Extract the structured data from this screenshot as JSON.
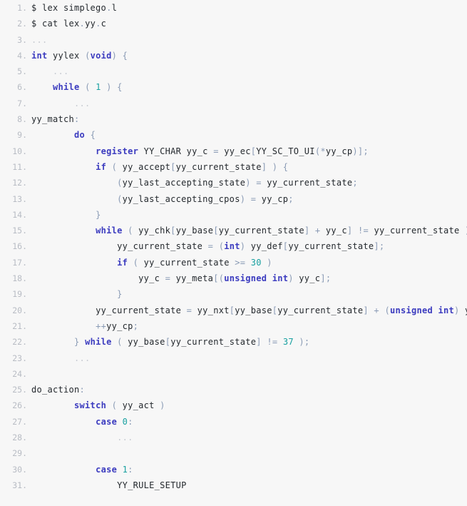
{
  "view": {
    "kind": "code-listing",
    "language": "c",
    "background_color": "#f7f7f7",
    "gutter_color": "#b8bcc4",
    "text_color": "#24292e",
    "keyword_color": "#3b3bbf",
    "number_color": "#18a0a0",
    "punctuation_color": "#8a9bb5",
    "ellipsis_color": "#c6cad1",
    "first_line_number": 1,
    "last_line_number": 31,
    "total_lines": 31
  },
  "lines": [
    {
      "n": "1",
      "text": "$ lex simplego.l",
      "tokens": [
        {
          "t": "$ lex simplego",
          "c": "t-plain"
        },
        {
          "t": ".",
          "c": "t-punct"
        },
        {
          "t": "l",
          "c": "t-plain"
        }
      ]
    },
    {
      "n": "2",
      "text": "$ cat lex.yy.c",
      "tokens": [
        {
          "t": "$ cat lex",
          "c": "t-plain"
        },
        {
          "t": ".",
          "c": "t-punct"
        },
        {
          "t": "yy",
          "c": "t-plain"
        },
        {
          "t": ".",
          "c": "t-punct"
        },
        {
          "t": "c",
          "c": "t-plain"
        }
      ]
    },
    {
      "n": "3",
      "text": "...",
      "tokens": [
        {
          "t": "...",
          "c": "t-dim"
        }
      ]
    },
    {
      "n": "4",
      "text": "int yylex (void) {",
      "tokens": [
        {
          "t": "int",
          "c": "t-type"
        },
        {
          "t": " yylex ",
          "c": "t-ident"
        },
        {
          "t": "(",
          "c": "t-punct"
        },
        {
          "t": "void",
          "c": "t-type"
        },
        {
          "t": ") {",
          "c": "t-punct"
        }
      ]
    },
    {
      "n": "5",
      "text": "    ...",
      "tokens": [
        {
          "t": "    ",
          "c": "t-plain"
        },
        {
          "t": "...",
          "c": "t-dim"
        }
      ]
    },
    {
      "n": "6",
      "text": "    while ( 1 ) {",
      "tokens": [
        {
          "t": "    ",
          "c": "t-plain"
        },
        {
          "t": "while",
          "c": "t-kw"
        },
        {
          "t": " ",
          "c": "t-plain"
        },
        {
          "t": "(",
          "c": "t-punct"
        },
        {
          "t": " ",
          "c": "t-plain"
        },
        {
          "t": "1",
          "c": "t-num"
        },
        {
          "t": " ",
          "c": "t-plain"
        },
        {
          "t": ") {",
          "c": "t-punct"
        }
      ]
    },
    {
      "n": "7",
      "text": "        ...",
      "tokens": [
        {
          "t": "        ",
          "c": "t-plain"
        },
        {
          "t": "...",
          "c": "t-dim"
        }
      ]
    },
    {
      "n": "8",
      "text": "yy_match:",
      "tokens": [
        {
          "t": "yy_match",
          "c": "t-label"
        },
        {
          "t": ":",
          "c": "t-punct"
        }
      ]
    },
    {
      "n": "9",
      "text": "        do {",
      "tokens": [
        {
          "t": "        ",
          "c": "t-plain"
        },
        {
          "t": "do",
          "c": "t-kw"
        },
        {
          "t": " ",
          "c": "t-plain"
        },
        {
          "t": "{",
          "c": "t-punct"
        }
      ]
    },
    {
      "n": "10",
      "text": "            register YY_CHAR yy_c = yy_ec[YY_SC_TO_UI(*yy_cp)];",
      "tokens": [
        {
          "t": "            ",
          "c": "t-plain"
        },
        {
          "t": "register",
          "c": "t-kw"
        },
        {
          "t": " YY_CHAR yy_c ",
          "c": "t-ident"
        },
        {
          "t": "=",
          "c": "t-op"
        },
        {
          "t": " yy_ec",
          "c": "t-ident"
        },
        {
          "t": "[",
          "c": "t-punct"
        },
        {
          "t": "YY_SC_TO_UI",
          "c": "t-ident"
        },
        {
          "t": "(*",
          "c": "t-punct"
        },
        {
          "t": "yy_cp",
          "c": "t-ident"
        },
        {
          "t": ")];",
          "c": "t-punct"
        }
      ]
    },
    {
      "n": "11",
      "text": "            if ( yy_accept[yy_current_state] ) {",
      "tokens": [
        {
          "t": "            ",
          "c": "t-plain"
        },
        {
          "t": "if",
          "c": "t-kw"
        },
        {
          "t": " ",
          "c": "t-plain"
        },
        {
          "t": "(",
          "c": "t-punct"
        },
        {
          "t": " yy_accept",
          "c": "t-ident"
        },
        {
          "t": "[",
          "c": "t-punct"
        },
        {
          "t": "yy_current_state",
          "c": "t-ident"
        },
        {
          "t": "]",
          "c": "t-punct"
        },
        {
          "t": " ",
          "c": "t-plain"
        },
        {
          "t": ") {",
          "c": "t-punct"
        }
      ]
    },
    {
      "n": "12",
      "text": "                (yy_last_accepting_state) = yy_current_state;",
      "tokens": [
        {
          "t": "                ",
          "c": "t-plain"
        },
        {
          "t": "(",
          "c": "t-punct"
        },
        {
          "t": "yy_last_accepting_state",
          "c": "t-ident"
        },
        {
          "t": ")",
          "c": "t-punct"
        },
        {
          "t": " ",
          "c": "t-plain"
        },
        {
          "t": "=",
          "c": "t-op"
        },
        {
          "t": " yy_current_state",
          "c": "t-ident"
        },
        {
          "t": ";",
          "c": "t-punct"
        }
      ]
    },
    {
      "n": "13",
      "text": "                (yy_last_accepting_cpos) = yy_cp;",
      "tokens": [
        {
          "t": "                ",
          "c": "t-plain"
        },
        {
          "t": "(",
          "c": "t-punct"
        },
        {
          "t": "yy_last_accepting_cpos",
          "c": "t-ident"
        },
        {
          "t": ")",
          "c": "t-punct"
        },
        {
          "t": " ",
          "c": "t-plain"
        },
        {
          "t": "=",
          "c": "t-op"
        },
        {
          "t": " yy_cp",
          "c": "t-ident"
        },
        {
          "t": ";",
          "c": "t-punct"
        }
      ]
    },
    {
      "n": "14",
      "text": "            }",
      "tokens": [
        {
          "t": "            ",
          "c": "t-plain"
        },
        {
          "t": "}",
          "c": "t-punct"
        }
      ]
    },
    {
      "n": "15",
      "text": "            while ( yy_chk[yy_base[yy_current_state] + yy_c] != yy_current_state ) {",
      "tokens": [
        {
          "t": "            ",
          "c": "t-plain"
        },
        {
          "t": "while",
          "c": "t-kw"
        },
        {
          "t": " ",
          "c": "t-plain"
        },
        {
          "t": "(",
          "c": "t-punct"
        },
        {
          "t": " yy_chk",
          "c": "t-ident"
        },
        {
          "t": "[",
          "c": "t-punct"
        },
        {
          "t": "yy_base",
          "c": "t-ident"
        },
        {
          "t": "[",
          "c": "t-punct"
        },
        {
          "t": "yy_current_state",
          "c": "t-ident"
        },
        {
          "t": "]",
          "c": "t-punct"
        },
        {
          "t": " ",
          "c": "t-plain"
        },
        {
          "t": "+",
          "c": "t-op"
        },
        {
          "t": " yy_c",
          "c": "t-ident"
        },
        {
          "t": "]",
          "c": "t-punct"
        },
        {
          "t": " ",
          "c": "t-plain"
        },
        {
          "t": "!=",
          "c": "t-op"
        },
        {
          "t": " yy_current_state ",
          "c": "t-ident"
        },
        {
          "t": ") {",
          "c": "t-punct"
        }
      ]
    },
    {
      "n": "16",
      "text": "                yy_current_state = (int) yy_def[yy_current_state];",
      "tokens": [
        {
          "t": "                ",
          "c": "t-plain"
        },
        {
          "t": "yy_current_state ",
          "c": "t-ident"
        },
        {
          "t": "=",
          "c": "t-op"
        },
        {
          "t": " ",
          "c": "t-plain"
        },
        {
          "t": "(",
          "c": "t-punct"
        },
        {
          "t": "int",
          "c": "t-type"
        },
        {
          "t": ")",
          "c": "t-punct"
        },
        {
          "t": " yy_def",
          "c": "t-ident"
        },
        {
          "t": "[",
          "c": "t-punct"
        },
        {
          "t": "yy_current_state",
          "c": "t-ident"
        },
        {
          "t": "];",
          "c": "t-punct"
        }
      ]
    },
    {
      "n": "17",
      "text": "                if ( yy_current_state >= 30 )",
      "tokens": [
        {
          "t": "                ",
          "c": "t-plain"
        },
        {
          "t": "if",
          "c": "t-kw"
        },
        {
          "t": " ",
          "c": "t-plain"
        },
        {
          "t": "(",
          "c": "t-punct"
        },
        {
          "t": " yy_current_state ",
          "c": "t-ident"
        },
        {
          "t": ">=",
          "c": "t-op"
        },
        {
          "t": " ",
          "c": "t-plain"
        },
        {
          "t": "30",
          "c": "t-num"
        },
        {
          "t": " ",
          "c": "t-plain"
        },
        {
          "t": ")",
          "c": "t-punct"
        }
      ]
    },
    {
      "n": "18",
      "text": "                    yy_c = yy_meta[(unsigned int) yy_c];",
      "tokens": [
        {
          "t": "                    ",
          "c": "t-plain"
        },
        {
          "t": "yy_c ",
          "c": "t-ident"
        },
        {
          "t": "=",
          "c": "t-op"
        },
        {
          "t": " yy_meta",
          "c": "t-ident"
        },
        {
          "t": "[(",
          "c": "t-punct"
        },
        {
          "t": "unsigned int",
          "c": "t-type"
        },
        {
          "t": ")",
          "c": "t-punct"
        },
        {
          "t": " yy_c",
          "c": "t-ident"
        },
        {
          "t": "];",
          "c": "t-punct"
        }
      ]
    },
    {
      "n": "19",
      "text": "                }",
      "tokens": [
        {
          "t": "                ",
          "c": "t-plain"
        },
        {
          "t": "}",
          "c": "t-punct"
        }
      ]
    },
    {
      "n": "20",
      "text": "            yy_current_state = yy_nxt[yy_base[yy_current_state] + (unsigned int) yy_c];",
      "tokens": [
        {
          "t": "            ",
          "c": "t-plain"
        },
        {
          "t": "yy_current_state ",
          "c": "t-ident"
        },
        {
          "t": "=",
          "c": "t-op"
        },
        {
          "t": " yy_nxt",
          "c": "t-ident"
        },
        {
          "t": "[",
          "c": "t-punct"
        },
        {
          "t": "yy_base",
          "c": "t-ident"
        },
        {
          "t": "[",
          "c": "t-punct"
        },
        {
          "t": "yy_current_state",
          "c": "t-ident"
        },
        {
          "t": "]",
          "c": "t-punct"
        },
        {
          "t": " ",
          "c": "t-plain"
        },
        {
          "t": "+",
          "c": "t-op"
        },
        {
          "t": " ",
          "c": "t-plain"
        },
        {
          "t": "(",
          "c": "t-punct"
        },
        {
          "t": "unsigned int",
          "c": "t-type"
        },
        {
          "t": ")",
          "c": "t-punct"
        },
        {
          "t": " yy_c",
          "c": "t-ident"
        },
        {
          "t": "];",
          "c": "t-punct"
        }
      ]
    },
    {
      "n": "21",
      "text": "            ++yy_cp;",
      "tokens": [
        {
          "t": "            ",
          "c": "t-plain"
        },
        {
          "t": "++",
          "c": "t-op"
        },
        {
          "t": "yy_cp",
          "c": "t-ident"
        },
        {
          "t": ";",
          "c": "t-punct"
        }
      ]
    },
    {
      "n": "22",
      "text": "        } while ( yy_base[yy_current_state] != 37 );",
      "tokens": [
        {
          "t": "        ",
          "c": "t-plain"
        },
        {
          "t": "}",
          "c": "t-punct"
        },
        {
          "t": " ",
          "c": "t-plain"
        },
        {
          "t": "while",
          "c": "t-kw"
        },
        {
          "t": " ",
          "c": "t-plain"
        },
        {
          "t": "(",
          "c": "t-punct"
        },
        {
          "t": " yy_base",
          "c": "t-ident"
        },
        {
          "t": "[",
          "c": "t-punct"
        },
        {
          "t": "yy_current_state",
          "c": "t-ident"
        },
        {
          "t": "]",
          "c": "t-punct"
        },
        {
          "t": " ",
          "c": "t-plain"
        },
        {
          "t": "!=",
          "c": "t-op"
        },
        {
          "t": " ",
          "c": "t-plain"
        },
        {
          "t": "37",
          "c": "t-num"
        },
        {
          "t": " ",
          "c": "t-plain"
        },
        {
          "t": ");",
          "c": "t-punct"
        }
      ]
    },
    {
      "n": "23",
      "text": "        ...",
      "tokens": [
        {
          "t": "        ",
          "c": "t-plain"
        },
        {
          "t": "...",
          "c": "t-dim"
        }
      ]
    },
    {
      "n": "24",
      "text": "",
      "tokens": []
    },
    {
      "n": "25",
      "text": "do_action:",
      "tokens": [
        {
          "t": "do_action",
          "c": "t-label"
        },
        {
          "t": ":",
          "c": "t-punct"
        }
      ]
    },
    {
      "n": "26",
      "text": "        switch ( yy_act )",
      "tokens": [
        {
          "t": "        ",
          "c": "t-plain"
        },
        {
          "t": "switch",
          "c": "t-kw"
        },
        {
          "t": " ",
          "c": "t-plain"
        },
        {
          "t": "(",
          "c": "t-punct"
        },
        {
          "t": " yy_act ",
          "c": "t-ident"
        },
        {
          "t": ")",
          "c": "t-punct"
        }
      ]
    },
    {
      "n": "27",
      "text": "            case 0:",
      "tokens": [
        {
          "t": "            ",
          "c": "t-plain"
        },
        {
          "t": "case",
          "c": "t-kw"
        },
        {
          "t": " ",
          "c": "t-plain"
        },
        {
          "t": "0",
          "c": "t-num"
        },
        {
          "t": ":",
          "c": "t-punct"
        }
      ]
    },
    {
      "n": "28",
      "text": "                ...",
      "tokens": [
        {
          "t": "                ",
          "c": "t-plain"
        },
        {
          "t": "...",
          "c": "t-dim"
        }
      ]
    },
    {
      "n": "29",
      "text": "",
      "tokens": []
    },
    {
      "n": "30",
      "text": "            case 1:",
      "tokens": [
        {
          "t": "            ",
          "c": "t-plain"
        },
        {
          "t": "case",
          "c": "t-kw"
        },
        {
          "t": " ",
          "c": "t-plain"
        },
        {
          "t": "1",
          "c": "t-num"
        },
        {
          "t": ":",
          "c": "t-punct"
        }
      ]
    },
    {
      "n": "31",
      "text": "                YY_RULE_SETUP",
      "tokens": [
        {
          "t": "                ",
          "c": "t-plain"
        },
        {
          "t": "YY_RULE_SETUP",
          "c": "t-ident"
        }
      ]
    }
  ]
}
